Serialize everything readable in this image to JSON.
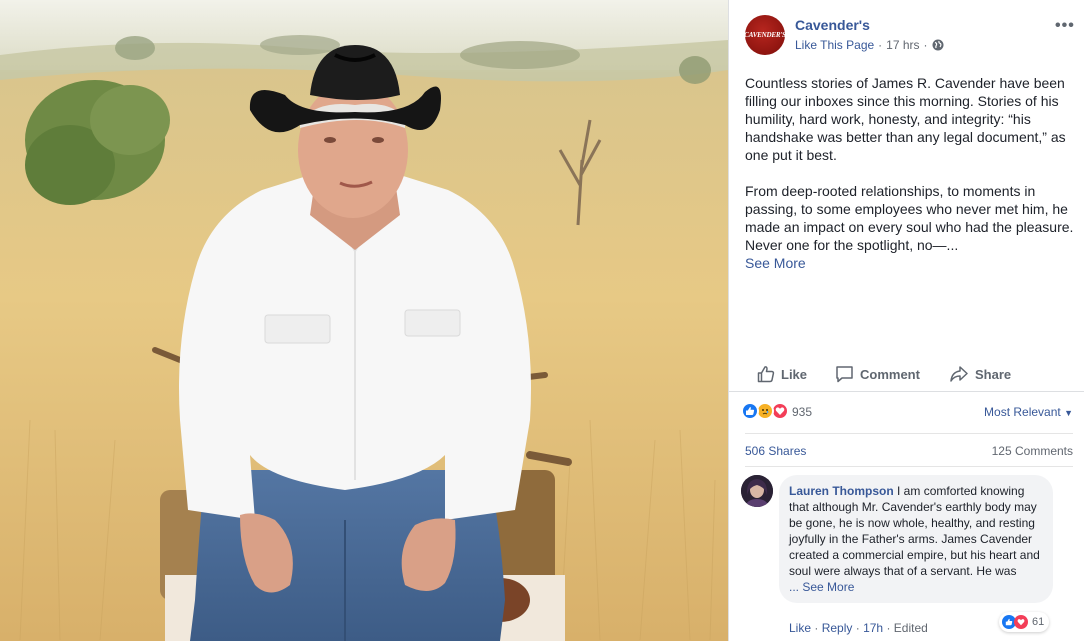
{
  "post": {
    "page_name": "Cavender's",
    "logo_text": "CAVENDER'S",
    "like_page": "Like This Page",
    "time": "17 hrs",
    "paragraph1": "Countless stories of James R. Cavender have been filling our inboxes since this morning. Stories of his humility, hard work, honesty, and integrity: “his handshake was better than any legal document,” as one put it best.",
    "paragraph2": "From deep-rooted relationships, to moments in passing, to some employees who never met him, he made an impact on every soul who had the pleasure. Never one for the spotlight, no—...",
    "see_more": "See More"
  },
  "actions": {
    "like": "Like",
    "comment": "Comment",
    "share": "Share"
  },
  "reactions": {
    "count": "935",
    "sort": "Most Relevant",
    "icons": [
      "like-icon",
      "sad-icon",
      "love-icon"
    ]
  },
  "stats": {
    "shares": "506 Shares",
    "comments": "125 Comments"
  },
  "comment": {
    "author": "Lauren Thompson",
    "text": "I am comforted knowing that although Mr. Cavender's earthly body may be gone, he is now whole, healthy, and resting joyfully in the Father's arms. James Cavender created a commercial empire, but his heart and soul were always that of a servant. He was",
    "more": "... See More",
    "reaction_count": "61",
    "like": "Like",
    "reply": "Reply",
    "time": "17h",
    "edited": "Edited",
    "sep": "·"
  },
  "colors": {
    "link": "#385898",
    "brand": "#8f1510",
    "like_blue": "#1877f2",
    "love_red": "#f33e58"
  }
}
